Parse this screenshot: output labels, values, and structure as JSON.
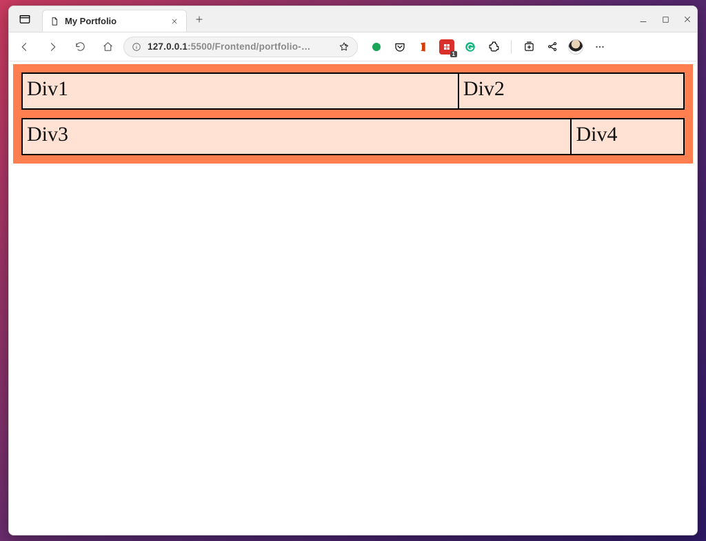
{
  "browser": {
    "tab": {
      "title": "My Portfolio"
    },
    "address": {
      "host": "127.0.0.1",
      "path": ":5500/Frontend/portfolio-…"
    },
    "extensions": {
      "red_badge": "1"
    }
  },
  "page": {
    "cells": {
      "div1": "Div1",
      "div2": "Div2",
      "div3": "Div3",
      "div4": "Div4"
    }
  },
  "colors": {
    "container_bg": "#ff7f50",
    "cell_bg": "#ffe2d4"
  }
}
